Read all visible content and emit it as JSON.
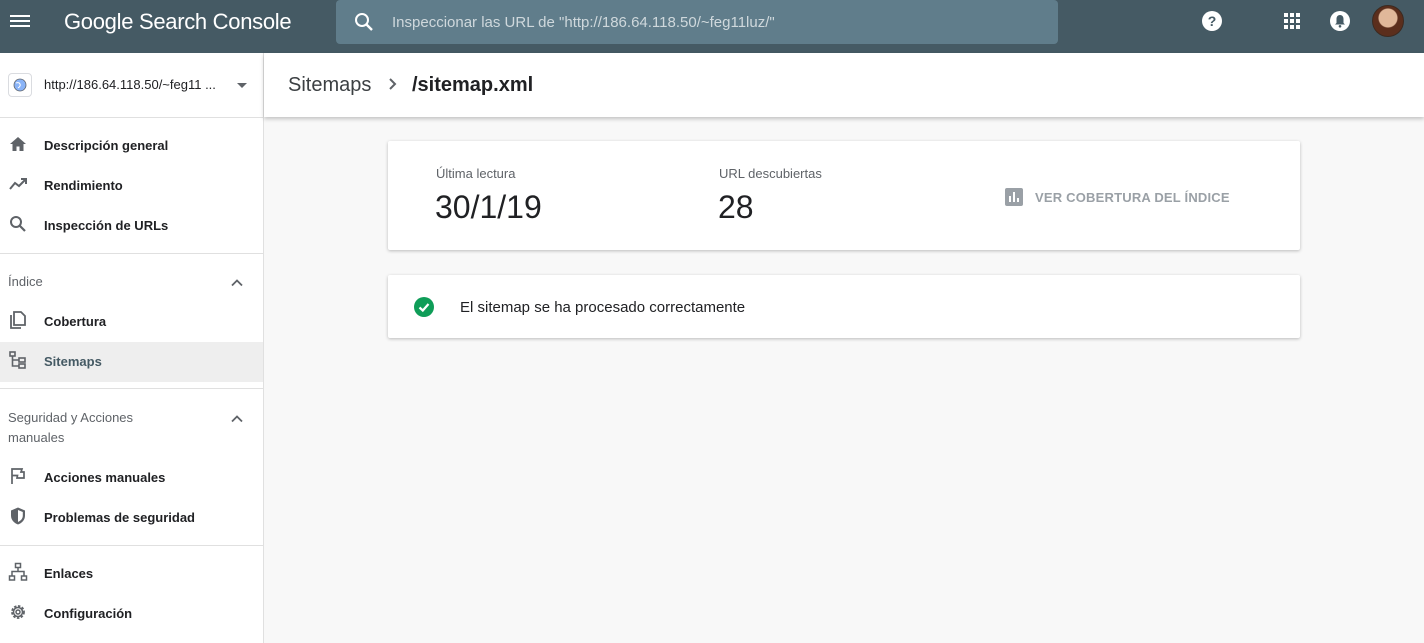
{
  "app": {
    "logo_text": "Google Search Console"
  },
  "search": {
    "placeholder": "Inspeccionar las URL de \"http://186.64.118.50/~feg11luz/\""
  },
  "property": {
    "label": "http://186.64.118.50/~feg11 ..."
  },
  "sidebar": {
    "top_items": [
      {
        "label": "Descripción general",
        "icon": "home-icon"
      },
      {
        "label": "Rendimiento",
        "icon": "trending-up-icon"
      },
      {
        "label": "Inspección de URLs",
        "icon": "search-icon"
      }
    ],
    "index_section": {
      "title": "Índice",
      "items": [
        {
          "label": "Cobertura",
          "icon": "copy-icon"
        },
        {
          "label": "Sitemaps",
          "icon": "sitemap-icon",
          "active": true
        }
      ]
    },
    "security_section": {
      "title": "Seguridad y Acciones manuales",
      "items": [
        {
          "label": "Acciones manuales",
          "icon": "flag-icon"
        },
        {
          "label": "Problemas de seguridad",
          "icon": "shield-icon"
        }
      ]
    },
    "bottom_items": [
      {
        "label": "Enlaces",
        "icon": "links-icon"
      },
      {
        "label": "Configuración",
        "icon": "gear-icon"
      }
    ]
  },
  "breadcrumb": {
    "parent": "Sitemaps",
    "current": "/sitemap.xml"
  },
  "stats": {
    "last_read_label": "Última lectura",
    "last_read_value": "30/1/19",
    "discovered_label": "URL descubiertas",
    "discovered_value": "28",
    "coverage_button": "VER COBERTURA DEL ÍNDICE"
  },
  "status": {
    "message": "El sitemap se ha procesado correctamente"
  },
  "colors": {
    "topbar": "#455a64",
    "search_bg": "#607d8b",
    "success": "#0f9d58"
  }
}
